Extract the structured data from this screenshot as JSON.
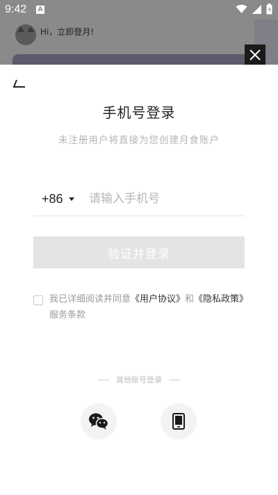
{
  "status_bar": {
    "time": "9:42",
    "notif_badge": "A"
  },
  "background": {
    "greeting": "Hi，立即登月!"
  },
  "modal": {
    "title": "手机号登录",
    "subtitle": "未注册用户将直接为您创建月食账户",
    "country_code": "+86",
    "phone_placeholder": "请输入手机号",
    "phone_value": "",
    "submit_label": "验证并登录",
    "agreement": {
      "prefix": "我已详细阅读并同意",
      "user_agreement": "《用户协议》",
      "and": "和",
      "privacy": "《隐私政策》",
      "suffix": "服务条款",
      "checked": false
    },
    "other_login_label": "其他账号登录",
    "social": [
      {
        "name": "wechat",
        "icon": "wechat-icon"
      },
      {
        "name": "phone",
        "icon": "phone-icon"
      }
    ]
  },
  "colors": {
    "accent_dark": "#1a1a1a",
    "button_disabled": "#e4e4e4",
    "placeholder": "#b6b6b6",
    "subtitle": "#b4b4b4"
  }
}
